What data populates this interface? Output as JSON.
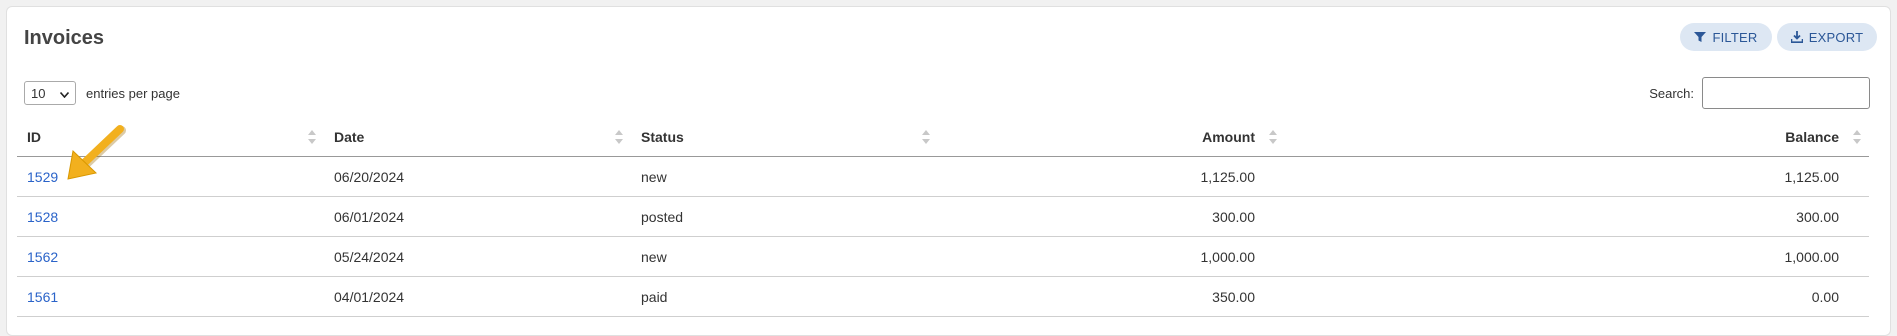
{
  "header": {
    "title": "Invoices",
    "filter_label": "FILTER",
    "export_label": "EXPORT"
  },
  "controls": {
    "page_size": "10",
    "entries_label": "entries per page",
    "search_label": "Search:",
    "search_value": ""
  },
  "table": {
    "columns": [
      "ID",
      "Date",
      "Status",
      "Amount",
      "Balance"
    ],
    "rows": [
      {
        "id": "1529",
        "date": "06/20/2024",
        "status": "new",
        "amount": "1,125.00",
        "balance": "1,125.00"
      },
      {
        "id": "1528",
        "date": "06/01/2024",
        "status": "posted",
        "amount": "300.00",
        "balance": "300.00"
      },
      {
        "id": "1562",
        "date": "05/24/2024",
        "status": "new",
        "amount": "1,000.00",
        "balance": "1,000.00"
      },
      {
        "id": "1561",
        "date": "04/01/2024",
        "status": "paid",
        "amount": "350.00",
        "balance": "0.00"
      }
    ]
  },
  "icons": {
    "filter": "filter-icon",
    "export": "download-icon",
    "sort": "sort-icon",
    "pointer": "arrow-pointer"
  },
  "colors": {
    "accent": "#2a63c9",
    "button_bg": "#dde7f3",
    "button_text": "#2b5797",
    "arrow": "#f2b01e"
  }
}
